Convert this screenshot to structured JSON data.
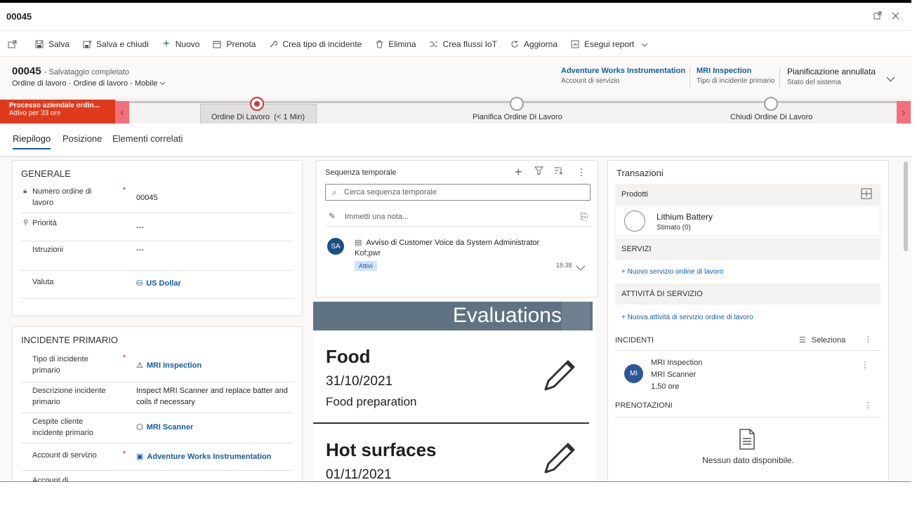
{
  "window": {
    "title": "00045",
    "popout_icon": "popout-icon",
    "close_icon": "close-icon"
  },
  "toolbar": {
    "items": [
      {
        "label": "Salva",
        "icon": "save-icon"
      },
      {
        "label": "Salva e chiudi",
        "icon": "save-close-icon"
      },
      {
        "label": "Nuovo",
        "icon": "plus-icon"
      },
      {
        "label": "Prenota",
        "icon": "calendar-icon"
      },
      {
        "label": "Crea tipo di incidente",
        "icon": "wrench-icon"
      },
      {
        "label": "Elimina",
        "icon": "trash-icon"
      },
      {
        "label": "Crea flussi IoT",
        "icon": "flow-icon"
      },
      {
        "label": "Aggiorna",
        "icon": "refresh-icon"
      },
      {
        "label": "Esegui report",
        "icon": "report-icon"
      }
    ]
  },
  "header": {
    "record_id": "00045",
    "save_status": "- Salvataggio completato",
    "entity": "Ordine di lavoro",
    "form": "Ordine di lavoro - Mobile",
    "fields": [
      {
        "value": "Adventure Works Instrumentation",
        "label": "Account di servizio"
      },
      {
        "value": "MRI Inspection",
        "label": "Tipo di incidente primario"
      },
      {
        "value": "Pianificazione annullata",
        "label": "Stato del sistema"
      }
    ]
  },
  "bpf": {
    "process_name": "Processo aziendale ordin...",
    "active_for": "Attivo per 33 ore",
    "stages": [
      {
        "label": "Ordine Di Lavoro",
        "duration": "(< 1 Min)"
      },
      {
        "label": "Pianifica Ordine Di Lavoro"
      },
      {
        "label": "Chiudi Ordine Di Lavoro"
      }
    ]
  },
  "tabs": [
    "Riepilogo",
    "Posizione",
    "Elementi correlati"
  ],
  "generale": {
    "title": "GENERALE",
    "fields": [
      {
        "label": "Numero ordine di lavoro",
        "value": "00045"
      },
      {
        "label": "Priorità",
        "value": "---"
      },
      {
        "label": "Istruzioni",
        "value": "---"
      },
      {
        "label": "Valuta",
        "value": "US Dollar"
      }
    ]
  },
  "incidente": {
    "title": "INCIDENTE PRIMARIO",
    "fields": [
      {
        "label": "Tipo di incidente primario",
        "value": "MRI Inspection"
      },
      {
        "label": "Descrizione incidente primario",
        "value": "Inspect MRI Scanner and replace batter and coils if necessary"
      },
      {
        "label": "Cespite cliente incidente primario",
        "value": "MRI Scanner"
      },
      {
        "label": "Account di servizio",
        "value": "Adventure Works Instrumentation"
      },
      {
        "label": "Account di",
        "value": ""
      }
    ]
  },
  "timeline": {
    "title": "Sequenza temporale",
    "search_placeholder": "Cerca sequenza temporale",
    "note_placeholder": "Immetti una nota...",
    "entry": {
      "avatar": "SA",
      "title": "Avviso di Customer Voice da System Administrator",
      "subtitle": "Kof;pwr",
      "badge": "Attivi",
      "time": "18:38"
    }
  },
  "evaluations": {
    "title": "Evaluations",
    "items": [
      {
        "name": "Food",
        "date": "31/10/2021",
        "desc": "Food preparation"
      },
      {
        "name": "Hot surfaces",
        "date": "01/11/2021",
        "desc": ""
      }
    ]
  },
  "transazioni": {
    "title": "Transazioni",
    "prodotti": {
      "title": "Prodotti",
      "item": "Lithium Battery",
      "status": "Stimato (0)"
    },
    "servizi": {
      "title": "SERVIZI",
      "link": "+ Nuovo servizio ordine di lavoro"
    },
    "attivita": {
      "title": "ATTIVITÀ DI SERVIZIO",
      "link": "+ Nuova attività di servizio ordine di lavoro"
    },
    "incidenti": {
      "title": "INCIDENTI",
      "select": "Seleziona",
      "avatar": "MI",
      "line1": "MRI Inspection",
      "line2": "MRI Scanner",
      "line3": "1,50 ore"
    },
    "prenotazioni": {
      "title": "PRENOTAZIONI",
      "empty": "Nessun dato disponibile."
    }
  }
}
